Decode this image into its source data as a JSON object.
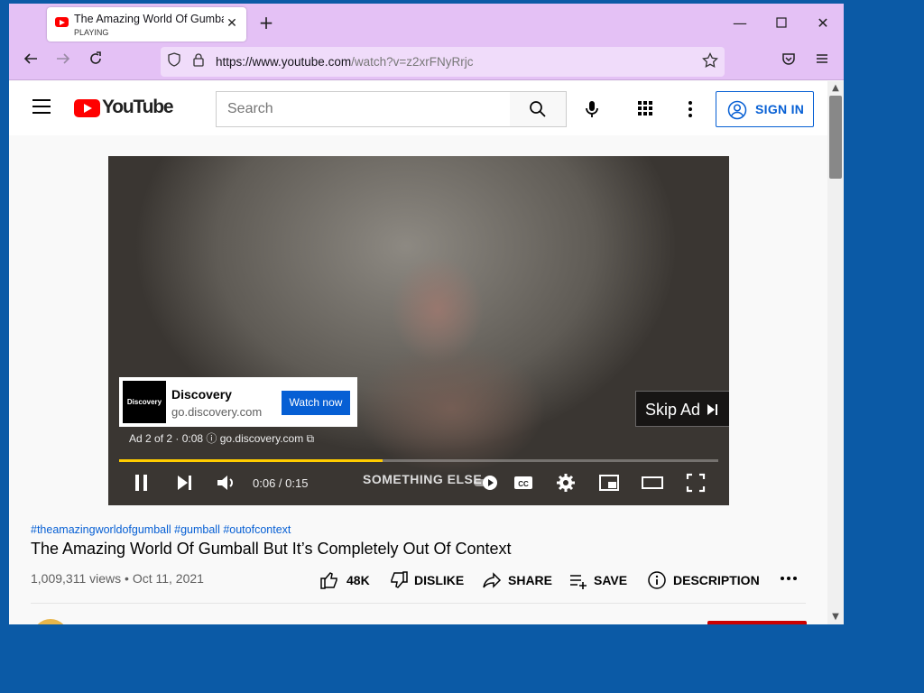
{
  "browser": {
    "tab_title": "The Amazing World Of Gumball But It's Completely Out Of Context",
    "tab_status": "PLAYING",
    "url_scheme_host": "https://www.youtube.com",
    "url_path": "/watch?v=z2xrFNyRrjc"
  },
  "youtube": {
    "logo_text": "YouTube",
    "search_placeholder": "Search",
    "signin_label": "SIGN IN"
  },
  "ad": {
    "logo_text": "Discovery",
    "advertiser": "Discovery",
    "domain": "go.discovery.com",
    "cta": "Watch now",
    "info": "Ad 2 of 2 · 0:08  ⓘ  go.discovery.com ⧉",
    "skip_label": "Skip Ad"
  },
  "player": {
    "time": "0:06 / 0:15",
    "progress_fraction": 0.44,
    "subtitle_overlay": "SOMETHING ELSE"
  },
  "video": {
    "hashtags": "#theamazingworldofgumball #gumball #outofcontext",
    "title": "The Amazing World Of Gumball But It’s Completely Out Of Context",
    "views_date": "1,009,311 views • Oct 11, 2021",
    "like_count": "48K",
    "dislike_label": "DISLIKE",
    "share_label": "SHARE",
    "save_label": "SAVE",
    "description_label": "DESCRIPTION"
  },
  "colors": {
    "accent_blue": "#065fd4",
    "youtube_red": "#ff0000",
    "progress_yellow": "#ffcc00",
    "browser_chrome": "#e4c1f5"
  }
}
